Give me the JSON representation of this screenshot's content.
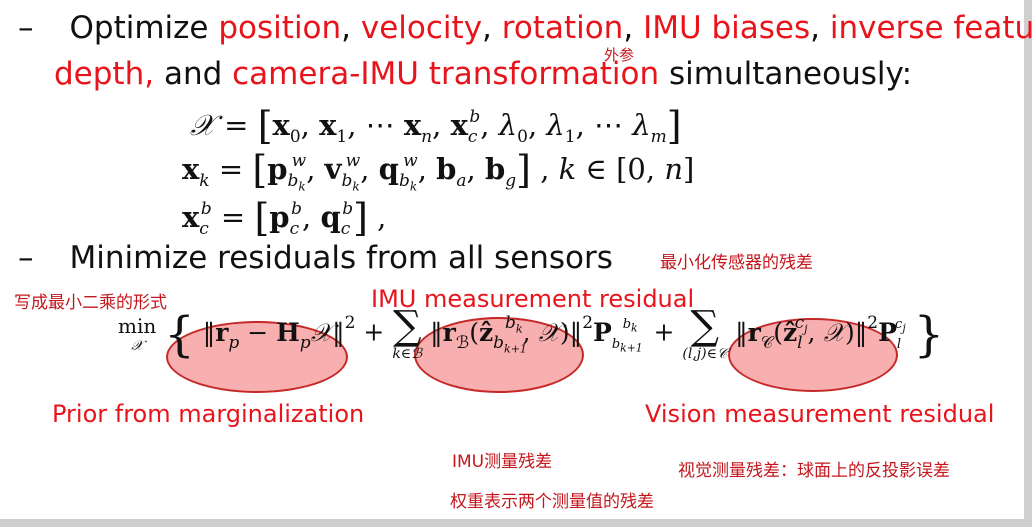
{
  "bullet1": {
    "dash": "–",
    "intro": "Optimize",
    "items": [
      "position",
      "velocity",
      "rotation",
      "IMU biases",
      "inverse feature",
      "depth,",
      "and",
      "camera-IMU transformation",
      "simultaneously:"
    ],
    "sep": ","
  },
  "annotation_extrinsic": "外参",
  "equations": {
    "state": "𝒳 = [x₀, x₁, ⋯ xₙ, x_c^b, λ₀, λ₁, ⋯ λₘ]",
    "xk": "x_k = [p^w_{b_k}, v^w_{b_k}, q^w_{b_k}, b_a, b_g], k ∈ [0, n]",
    "xcb": "x_c^b = [p_c^b, q_c^b],"
  },
  "bullet2": {
    "dash": "–",
    "text": "Minimize residuals from all sensors"
  },
  "notes": {
    "minimize_sensors": "最小化传感器的残差",
    "least_squares": "写成最小二乘的形式",
    "imu_residual": "IMU测量残差",
    "visual_residual": "视觉测量残差：球面上的反投影误差",
    "weights": "权重表示两个测量值的残差"
  },
  "labels": {
    "imu": "IMU measurement residual",
    "prior": "Prior from marginalization",
    "vision": "Vision measurement residual"
  },
  "objective": {
    "min": "min",
    "min_sub": "𝒳",
    "prior_term": "‖r_p − H_p𝒳‖²",
    "plus": "+",
    "sum1_sub": "k∈ℬ",
    "imu_term": "‖r_ℬ(ẑ^{b_k}_{b_{k+1}}, 𝒳)‖²",
    "imu_weight": "P^{b_k}_{b_{k+1}}",
    "sum2_sub": "(l,j)∈𝒞",
    "vis_term": "‖r_𝒞(ẑ^{c_j}_l, 𝒳)‖²",
    "vis_weight": "P^{c_j}_l"
  }
}
